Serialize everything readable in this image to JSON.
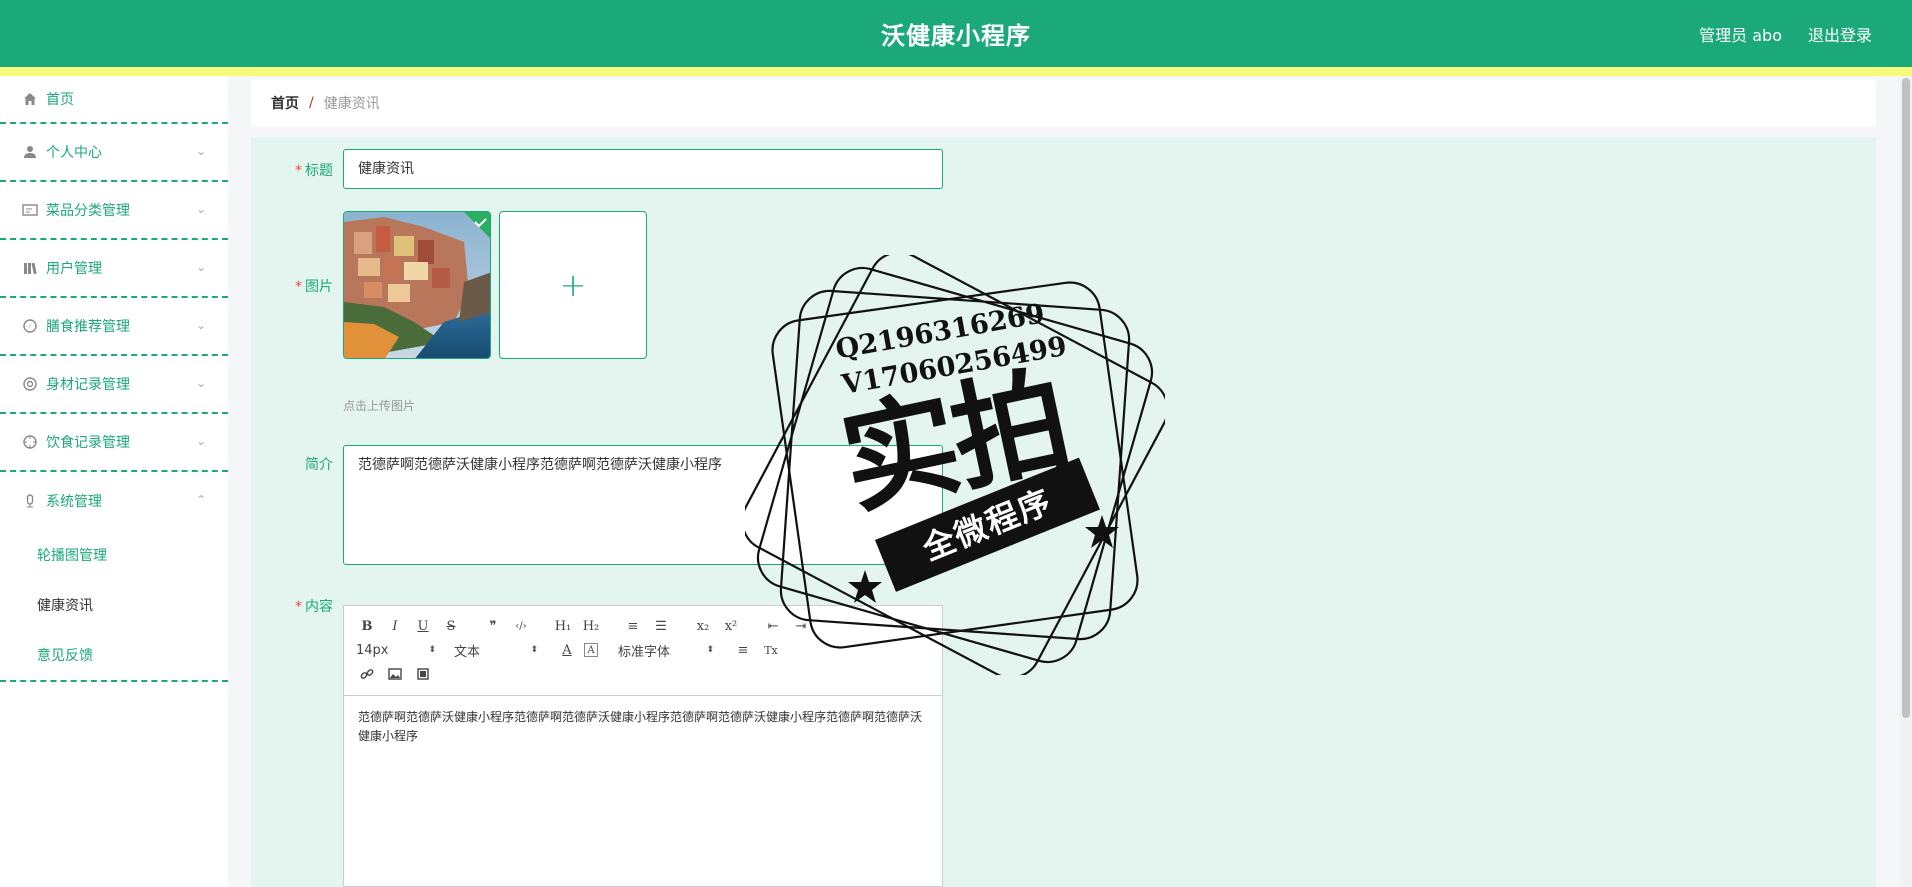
{
  "header": {
    "title": "沃健康小程序",
    "user": "管理员 abo",
    "logout": "退出登录"
  },
  "sidebar": {
    "items": [
      {
        "label": "首页",
        "icon": "home-icon"
      },
      {
        "label": "个人中心",
        "icon": "user-icon"
      },
      {
        "label": "菜品分类管理",
        "icon": "card-icon"
      },
      {
        "label": "用户管理",
        "icon": "library-icon"
      },
      {
        "label": "膳食推荐管理",
        "icon": "compass-icon"
      },
      {
        "label": "身材记录管理",
        "icon": "lifebuoy-icon"
      },
      {
        "label": "饮食记录管理",
        "icon": "crosshair-icon"
      },
      {
        "label": "系统管理",
        "icon": "microphone-icon"
      }
    ],
    "sub_items": [
      {
        "label": "轮播图管理",
        "active": false
      },
      {
        "label": "健康资讯",
        "active": true
      },
      {
        "label": "意见反馈",
        "active": false
      }
    ]
  },
  "breadcrumb": {
    "home": "首页",
    "separator": "/",
    "current": "健康资讯"
  },
  "form": {
    "title_label": "标题",
    "title_value": "健康资讯",
    "image_label": "图片",
    "upload_hint": "点击上传图片",
    "intro_label": "简介",
    "intro_value": "范德萨啊范德萨沃健康小程序范德萨啊范德萨沃健康小程序",
    "content_label": "内容",
    "content_value": "范德萨啊范德萨沃健康小程序范德萨啊范德萨沃健康小程序范德萨啊范德萨沃健康小程序范德萨啊范德萨沃健康小程序"
  },
  "editor_toolbar": {
    "bold": "B",
    "italic": "I",
    "underline": "U",
    "strike": "S",
    "quote": "❞",
    "code": "‹/›",
    "h1": "H₁",
    "h2": "H₂",
    "ol": "≡",
    "ul": "☰",
    "sub": "x₂",
    "sup": "x²",
    "outdent": "⇤",
    "indent": "⇥",
    "size": "14px",
    "header": "文本",
    "font_color": "A",
    "bg_color": "A",
    "font": "标准字体",
    "align": "≡",
    "clean": "Tx",
    "link": "🔗",
    "image": "▣",
    "video": "▦"
  },
  "watermark": {
    "line1": "Q2196316269",
    "line2": "V17060256499",
    "big": "实拍",
    "ribbon": "全微程序"
  },
  "colors": {
    "primary": "#1ba97a",
    "accent": "#f6f97a",
    "background": "#e4f4ee"
  }
}
